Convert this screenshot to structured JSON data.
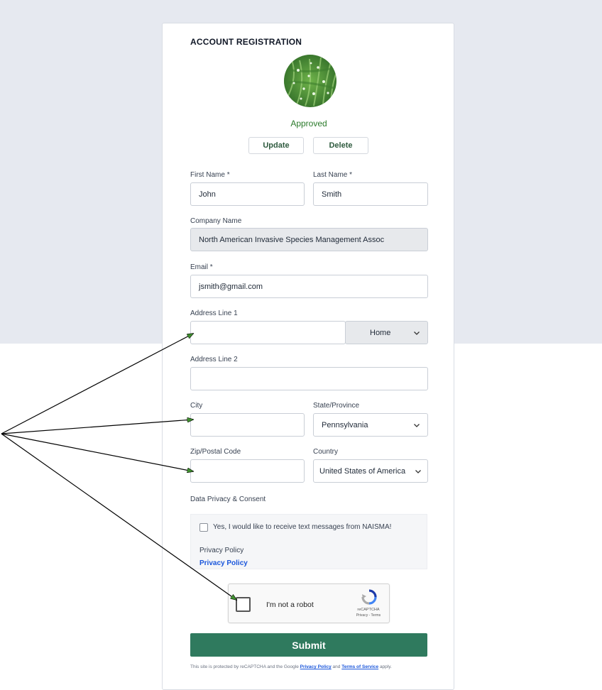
{
  "form": {
    "title": "ACCOUNT REGISTRATION",
    "status": "Approved",
    "update_label": "Update",
    "delete_label": "Delete",
    "first_name": {
      "label": "First Name",
      "value": "John"
    },
    "last_name": {
      "label": "Last Name",
      "value": "Smith"
    },
    "required_mark": "*",
    "company": {
      "label": "Company Name",
      "value": "North American Invasive Species Management Assoc"
    },
    "email": {
      "label": "Email",
      "value": "jsmith@gmail.com"
    },
    "address1": {
      "label": "Address Line 1",
      "value": "",
      "type_value": "Home"
    },
    "address2": {
      "label": "Address Line 2",
      "value": ""
    },
    "city": {
      "label": "City",
      "value": ""
    },
    "state": {
      "label": "State/Province",
      "value": "Pennsylvania"
    },
    "zip": {
      "label": "Zip/Postal Code",
      "value": ""
    },
    "country": {
      "label": "Country",
      "value": "United States of America"
    },
    "privacy_heading": "Data Privacy & Consent",
    "sms_consent_label": "Yes, I would like to receive text messages from NAISMA!",
    "privacy_policy_text": "Privacy Policy",
    "privacy_policy_link": "Privacy Policy",
    "submit_label": "Submit"
  },
  "recaptcha": {
    "label": "I'm not a robot",
    "brand": "reCAPTCHA",
    "links": "Privacy - Terms"
  },
  "footer": {
    "prefix": "This site is protected by reCAPTCHA and the Google",
    "privacy_link": "Privacy Policy",
    "and": "and",
    "terms_link": "Terms of Service",
    "suffix": "apply."
  },
  "colors": {
    "accent_green": "#2f7a5e",
    "approved_green": "#2a7a2a",
    "link_blue": "#1a56db",
    "top_background": "#e6e9f0"
  }
}
